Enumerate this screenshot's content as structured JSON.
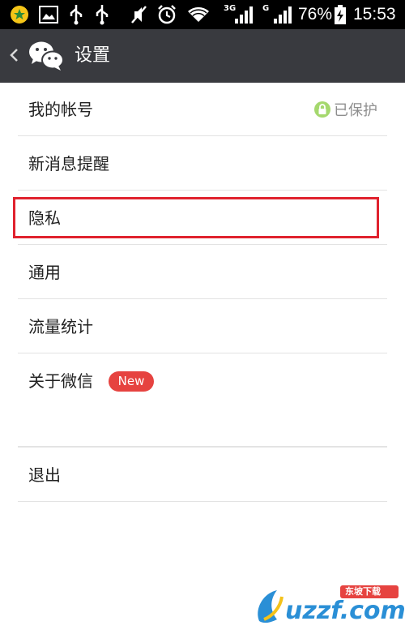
{
  "status_bar": {
    "battery_percent": "76%",
    "time": "15:53",
    "network_3g": "3G",
    "network_g": "G",
    "icons": [
      "app-notification-icon",
      "image-icon",
      "usb-icon",
      "usb-icon",
      "mute-icon",
      "alarm-icon",
      "wifi-icon",
      "signal-3g-icon",
      "signal-g-icon",
      "battery-charging-icon"
    ]
  },
  "action_bar": {
    "title": "设置",
    "back_icon": "chevron-left-icon",
    "logo_icon": "wechat-icon"
  },
  "settings": {
    "account": {
      "label": "我的帐号",
      "status": "已保护",
      "status_icon": "lock-icon"
    },
    "notifications": {
      "label": "新消息提醒"
    },
    "privacy": {
      "label": "隐私"
    },
    "general": {
      "label": "通用"
    },
    "data_usage": {
      "label": "流量统计"
    },
    "about": {
      "label": "关于微信",
      "badge": "New"
    },
    "logout": {
      "label": "退出"
    }
  },
  "watermark": {
    "text": "uzzf.com",
    "subtext": "东坡下载"
  },
  "colors": {
    "status_bar": "#000000",
    "action_bar": "#393a3f",
    "badge": "#e64340",
    "highlight": "#e0222e",
    "lock_green": "#a5d86e"
  }
}
